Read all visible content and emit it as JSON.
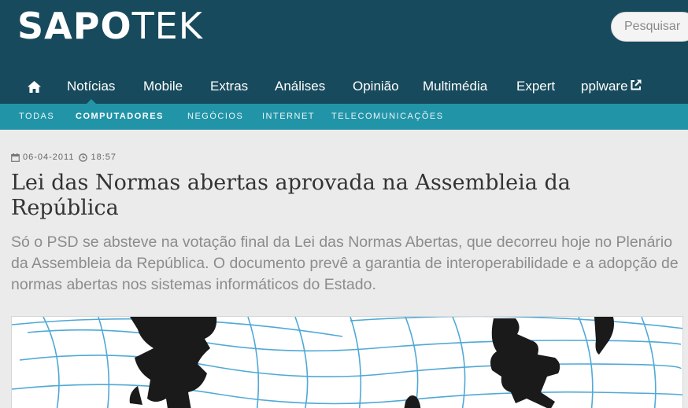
{
  "brand": {
    "logo_bold": "SAPO",
    "logo_light": "TEK"
  },
  "search": {
    "placeholder": "Pesquisar"
  },
  "main_nav": {
    "home_icon": "home-icon",
    "items": [
      {
        "label": "Notícias",
        "active": true
      },
      {
        "label": "Mobile"
      },
      {
        "label": "Extras"
      },
      {
        "label": "Análises"
      },
      {
        "label": "Opinião"
      },
      {
        "label": "Multimédia"
      },
      {
        "label": "Expert"
      },
      {
        "label": "pplware",
        "icon": "external-link-icon"
      }
    ]
  },
  "sub_nav": {
    "items": [
      {
        "label": "TODAS"
      },
      {
        "label": "COMPUTADORES",
        "active": true
      },
      {
        "label": "NEGÓCIOS"
      },
      {
        "label": "INTERNET"
      },
      {
        "label": "TELECOMUNICAÇÕES"
      }
    ]
  },
  "article": {
    "date": "06-04-2011",
    "time": "18:57",
    "title": "Lei das Normas abertas aprovada na Assembleia da República",
    "lead": "Só o PSD se absteve na votação final da Lei das Normas Abertas, que decorreu hoje no Plenário da Assembleia da República. O documento prevê a garantia de interoperabilidade e a adopção de normas abertas nos sistemas informáticos do Estado."
  },
  "colors": {
    "header_bg": "#174a5c",
    "subnav_bg": "#2294a8",
    "page_bg": "#ebebeb",
    "title_text": "#333333",
    "lead_text": "#8c8c8c",
    "web_lines": "#4fa9d6"
  }
}
